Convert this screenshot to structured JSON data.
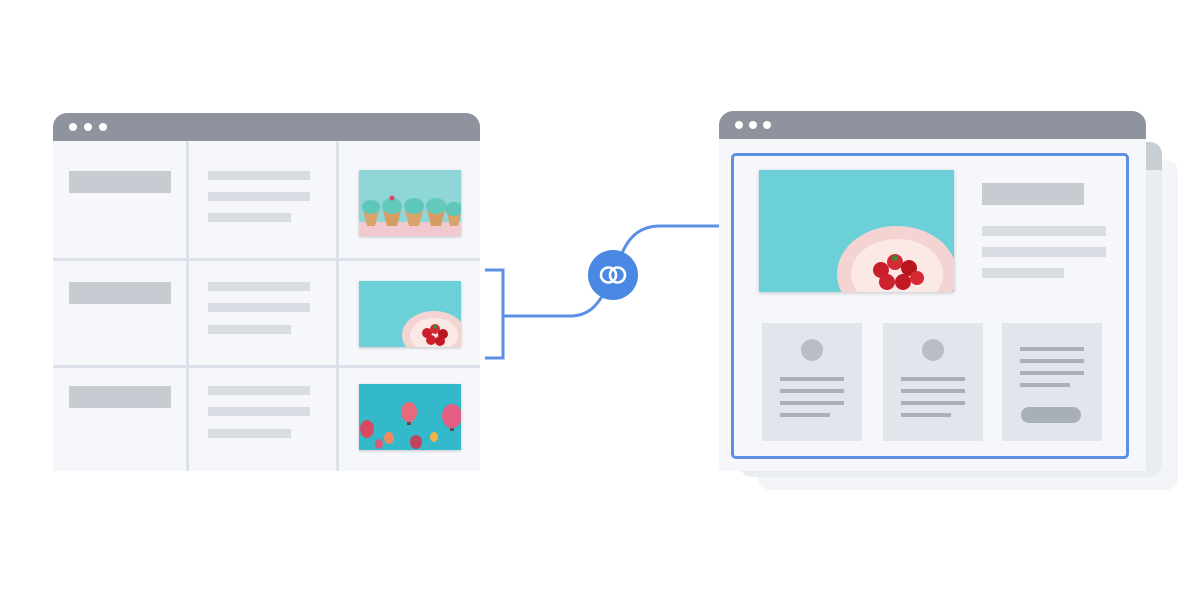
{
  "colors": {
    "accent": "#4a88e3",
    "selection": "#5b8fe6",
    "chrome": "#8e939d",
    "panel": "#f5f7fb",
    "placeholder": "#d9dde3"
  },
  "left_window": {
    "rows": [
      {
        "thumbnail": "cupcakes-photo"
      },
      {
        "thumbnail": "strawberries-photo",
        "selected": true
      },
      {
        "thumbnail": "hot-air-balloons-photo"
      }
    ]
  },
  "connector": {
    "icon": "link-icon"
  },
  "right_window": {
    "hero_image": "strawberries-photo",
    "cards": [
      {
        "type": "profile"
      },
      {
        "type": "profile"
      },
      {
        "type": "text-with-button"
      }
    ]
  }
}
